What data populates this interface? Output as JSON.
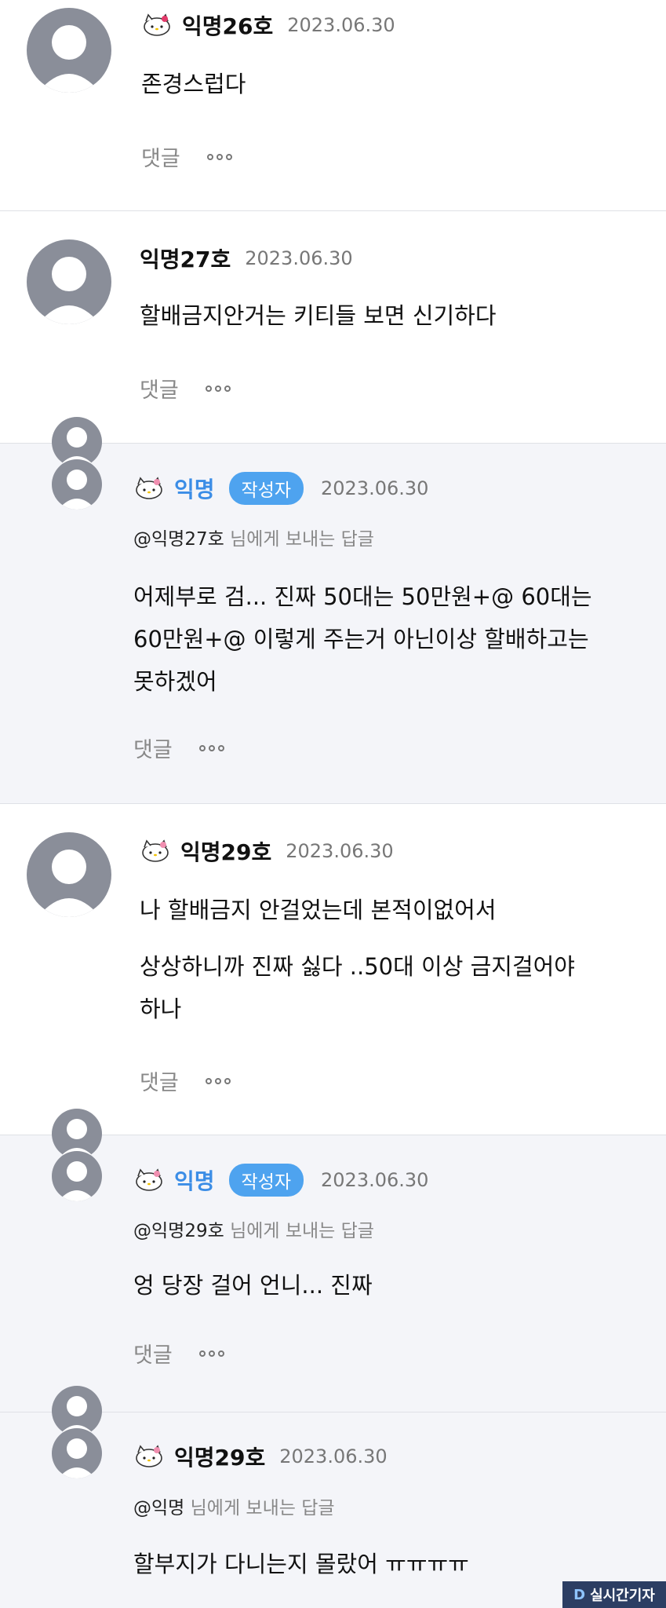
{
  "comments": [
    {
      "name": "익명26호",
      "date": "2023.06.30",
      "lines": [
        "존경스럽다"
      ],
      "reply_label": "댓글"
    },
    {
      "name": "익명27호",
      "date": "2023.06.30",
      "lines": [
        "할배금지안거는 키티들 보면 신기하다"
      ],
      "reply_label": "댓글"
    },
    {
      "name": "익명",
      "badge": "작성자",
      "date": "2023.06.30",
      "mention": "@익명27호",
      "mention_suffix": "님에게 보내는 답글",
      "lines": [
        "어제부로 검... 진짜 50대는 50만원+@ 60대는",
        "60만원+@ 이렇게 주는거 아닌이상 할배하고는",
        "못하겠어"
      ],
      "reply_label": "댓글"
    },
    {
      "name": "익명29호",
      "date": "2023.06.30",
      "lines": [
        "나 할배금지 안걸었는데 본적이없어서",
        "상상하니까 진짜 싫다 ..50대 이상 금지걸어야",
        "하나"
      ],
      "reply_label": "댓글"
    },
    {
      "name": "익명",
      "badge": "작성자",
      "date": "2023.06.30",
      "mention": "@익명29호",
      "mention_suffix": "님에게 보내는 답글",
      "lines": [
        "엉 당장 걸어 언니... 진짜"
      ],
      "reply_label": "댓글"
    },
    {
      "name": "익명29호",
      "date": "2023.06.30",
      "mention": "@익명",
      "mention_suffix": "님에게 보내는 답글",
      "lines": [
        "할부지가 다니는지 몰랐어 ㅠㅠㅠㅠ"
      ]
    }
  ],
  "icons": {
    "profile": "hello-kitty-icon",
    "more": "more-dots-icon",
    "avatar": "default-avatar-icon"
  },
  "colors": {
    "op_name": "#3b8de6",
    "badge_bg": "#4ea3ef",
    "reply_bg": "#f4f5f9"
  },
  "watermark": {
    "logo": "D",
    "text": "실시간기자"
  }
}
